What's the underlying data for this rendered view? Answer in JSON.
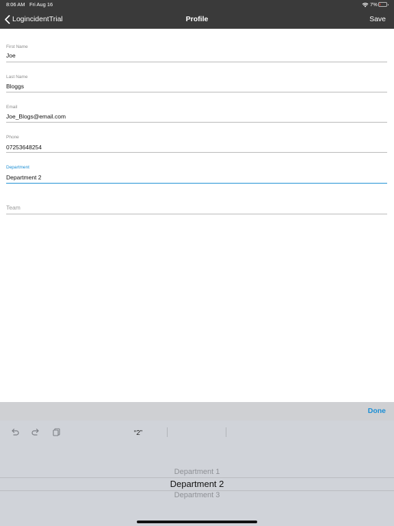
{
  "status_bar": {
    "time": "8:06 AM",
    "date": "Fri Aug 16",
    "battery_percent": "7%",
    "battery_level": 0.07,
    "icons": [
      "wifi-icon",
      "battery-icon"
    ]
  },
  "nav": {
    "back_label": "LogincidentTrial",
    "title": "Profile",
    "save_label": "Save",
    "bar_color": "#3a3a3a"
  },
  "form": {
    "first_name": {
      "label": "First Name",
      "value": "Joe"
    },
    "last_name": {
      "label": "Last Name",
      "value": "Bloggs"
    },
    "email": {
      "label": "Email",
      "value": "Joe_Blogs@email.com"
    },
    "phone": {
      "label": "Phone",
      "value": "07253648254"
    },
    "department": {
      "label": "Department",
      "value": "Department 2"
    },
    "team": {
      "placeholder": "Team"
    }
  },
  "keyboard": {
    "done_label": "Done",
    "suggestion": "“2”",
    "icons": [
      "undo-icon",
      "redo-icon",
      "paste-icon"
    ],
    "accent_color": "#1b8ed4"
  },
  "picker": {
    "options": [
      "Department 1",
      "Department 2",
      "Department 3"
    ],
    "selected": "Department 2"
  }
}
